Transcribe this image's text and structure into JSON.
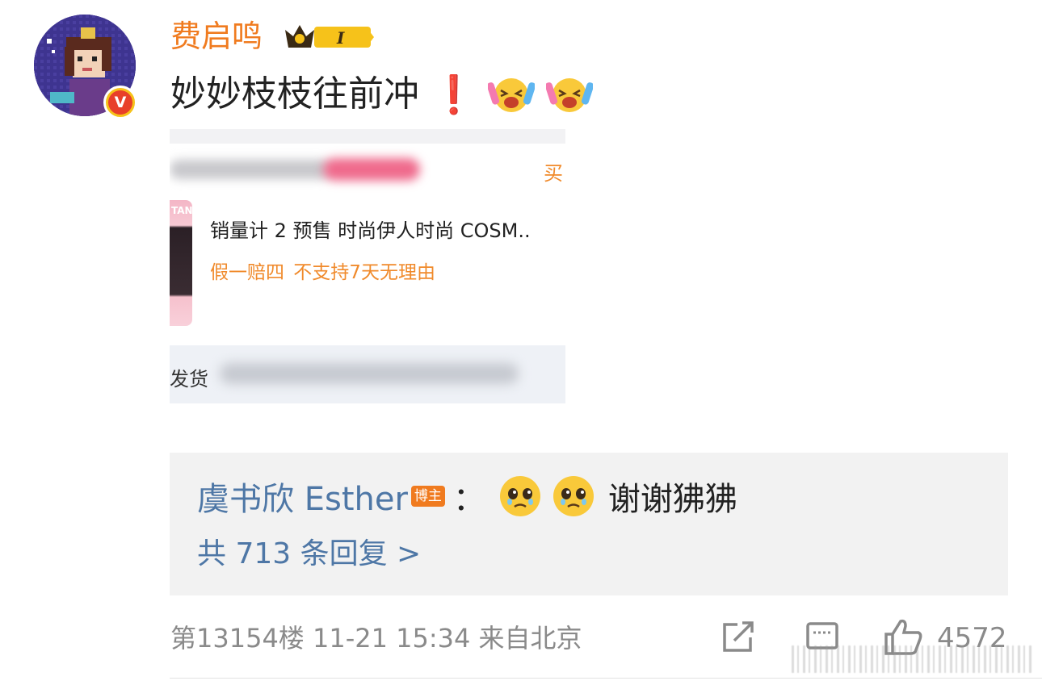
{
  "comment": {
    "username": "费启鸣",
    "vip_level": "I",
    "text": "妙妙枝枝往前冲",
    "exclamation": "❗"
  },
  "screenshot": {
    "buy_label": "买",
    "product_title": "销量计 2 预售 时尚伊人时尚 COSM..",
    "product_tags": "假一赔四  不支持7天无理由",
    "product_thumb_text": "TAN",
    "ship_label": "发货"
  },
  "reply": {
    "name": "虞书欣 Esther",
    "badge": "博主",
    "colon": "：",
    "text": "谢谢狒狒",
    "count_text": "共 713 条回复 >"
  },
  "footer": {
    "meta": "第13154楼  11-21 15:34  来自北京",
    "like_count": "4572"
  },
  "colors": {
    "username": "#f07b1f",
    "reply_link": "#4e77a6",
    "exclamation": "#e8202a",
    "tag_orange": "#f07b1f",
    "meta_gray": "#8a8a8a"
  },
  "icons": [
    "verified-v-icon",
    "vip-crown-icon",
    "laughing-cry-emoji",
    "pleading-emoji",
    "share-icon",
    "comment-icon",
    "like-icon"
  ]
}
